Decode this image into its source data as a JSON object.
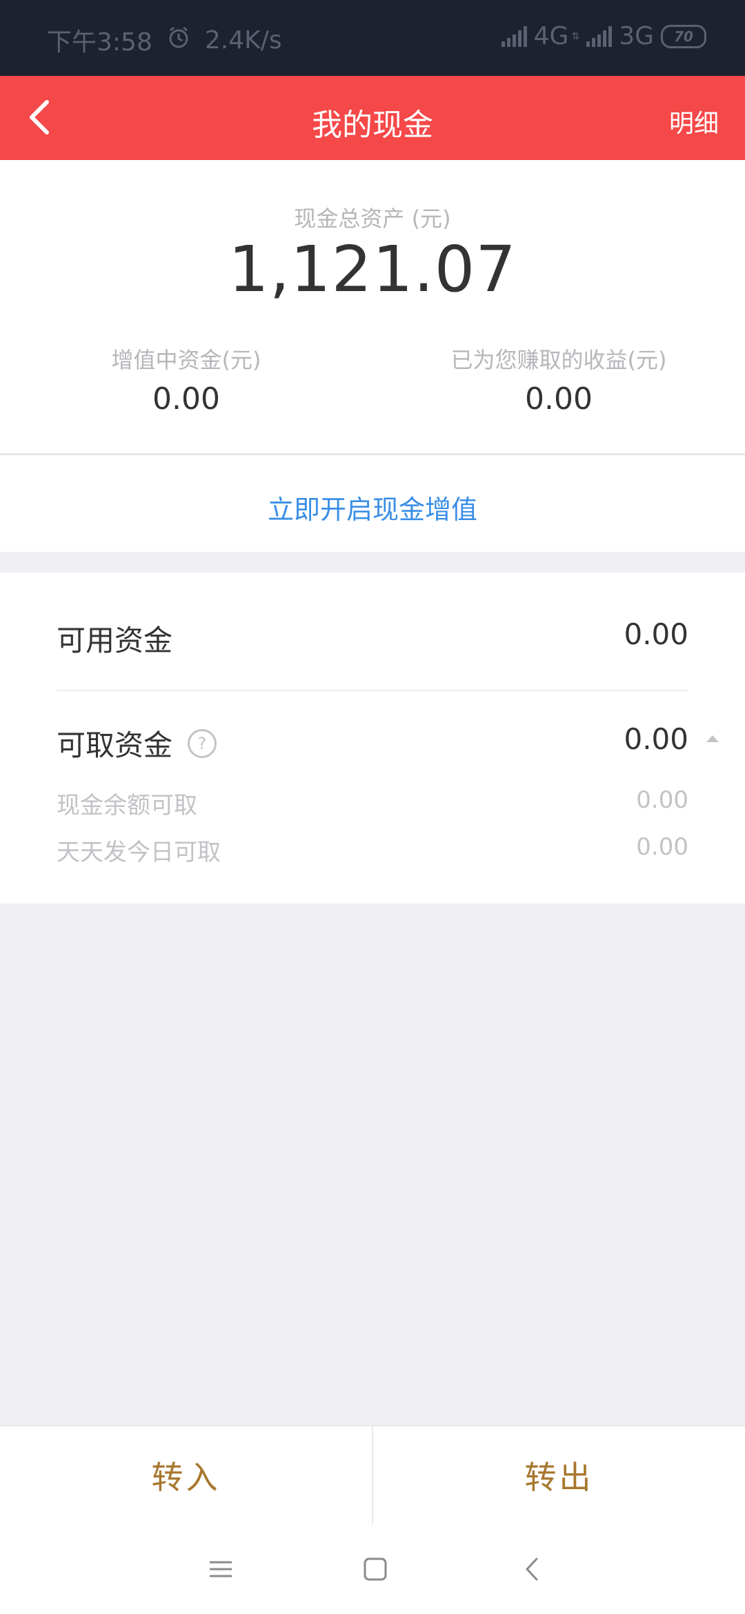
{
  "status_bar": {
    "time": "下午3:58",
    "net_speed": "2.4K/s",
    "network1": "4G",
    "network2": "3G",
    "battery": "70",
    "icons": [
      "alarm-icon",
      "signal-icon",
      "battery-icon"
    ]
  },
  "nav": {
    "title": "我的现金",
    "detail": "明细",
    "back_icon": "chevron-left-icon"
  },
  "summary": {
    "total_label": "现金总资产 (元)",
    "total_value": "1,121.07",
    "growing_label": "增值中资金(元)",
    "growing_value": "0.00",
    "earned_label": "已为您赚取的收益(元)",
    "earned_value": "0.00"
  },
  "activate": {
    "link": "立即开启现金增值"
  },
  "funds": {
    "available_label": "可用资金",
    "available_value": "0.00",
    "withdrawable_label": "可取资金",
    "withdrawable_value": "0.00",
    "sub_items": [
      {
        "label": "现金余额可取",
        "value": "0.00"
      },
      {
        "label": "天天发今日可取",
        "value": "0.00"
      }
    ]
  },
  "actions": {
    "in_label": "转入",
    "out_label": "转出"
  },
  "colors": {
    "nav_bg": "#f54848",
    "link": "#3a8ee6",
    "action": "#a8772d",
    "status_bg": "#1d2230"
  }
}
